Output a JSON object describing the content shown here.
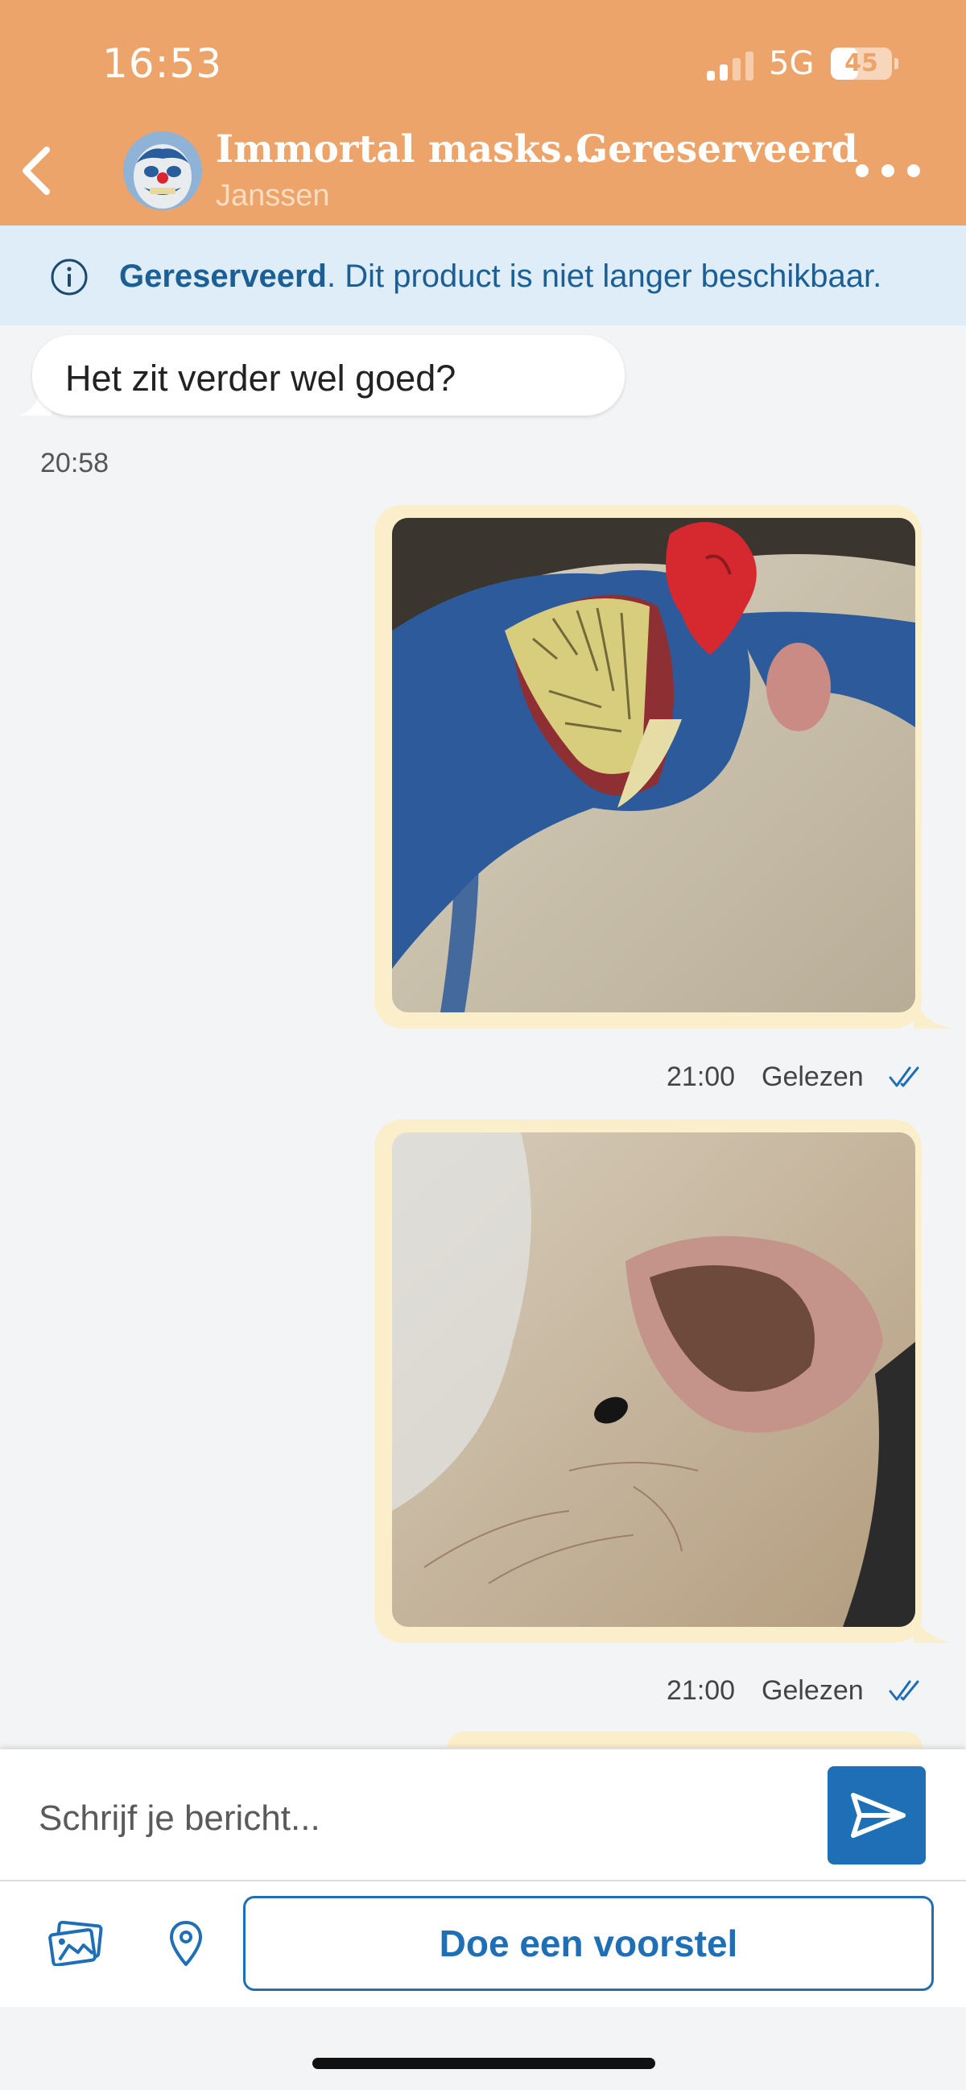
{
  "status_bar": {
    "time": "16:53",
    "network": "5G",
    "battery": "45",
    "battery_level": 0.45
  },
  "header": {
    "title": "Immortal masks...",
    "subtitle": "Janssen",
    "status": "Gereserveerd",
    "back_icon": "chevron-left-icon",
    "more_icon": "more-horizontal-icon",
    "color": "#eda46a"
  },
  "banner": {
    "bold": "Gereserveerd",
    "text": ". Dit product is niet langer beschikbaar.",
    "icon": "info-icon"
  },
  "messages": {
    "incoming": {
      "text": "Het zit verder wel goed?",
      "time": "20:58"
    },
    "photo1": {
      "time": "21:00",
      "status": "Gelezen"
    },
    "photo2": {
      "time": "21:00",
      "status": "Gelezen"
    }
  },
  "composer": {
    "placeholder": "Schrijf je bericht...",
    "offer_label": "Doe een voorstel",
    "accent": "#1e6fb5"
  }
}
